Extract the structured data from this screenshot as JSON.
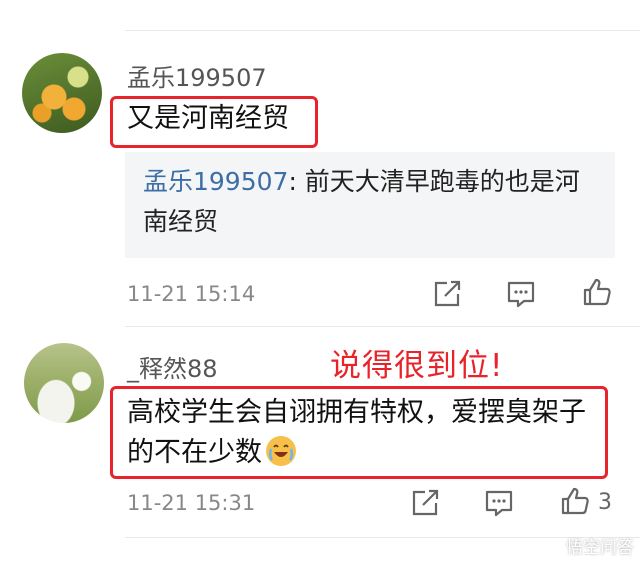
{
  "comments": [
    {
      "username": "孟乐199507",
      "text": "又是河南经贸",
      "quote": {
        "name": "孟乐199507",
        "text": ": 前天大清早跑毒的也是河南经贸"
      },
      "time": "11-21 15:14",
      "likes": ""
    },
    {
      "username": "_释然88",
      "text": "高校学生会自诩拥有特权，爱摆臭架子的不在少数",
      "time": "11-21 15:31",
      "likes": "3"
    }
  ],
  "annotation": "说得很到位!",
  "watermark": "悟空问答",
  "icons": [
    "share-icon",
    "reply-icon",
    "like-icon",
    "laugh-cry-emoji-icon"
  ],
  "colors": {
    "highlight": "#e8232a",
    "quote_name": "#3e6ea6",
    "quote_bg": "#f4f5f7"
  }
}
